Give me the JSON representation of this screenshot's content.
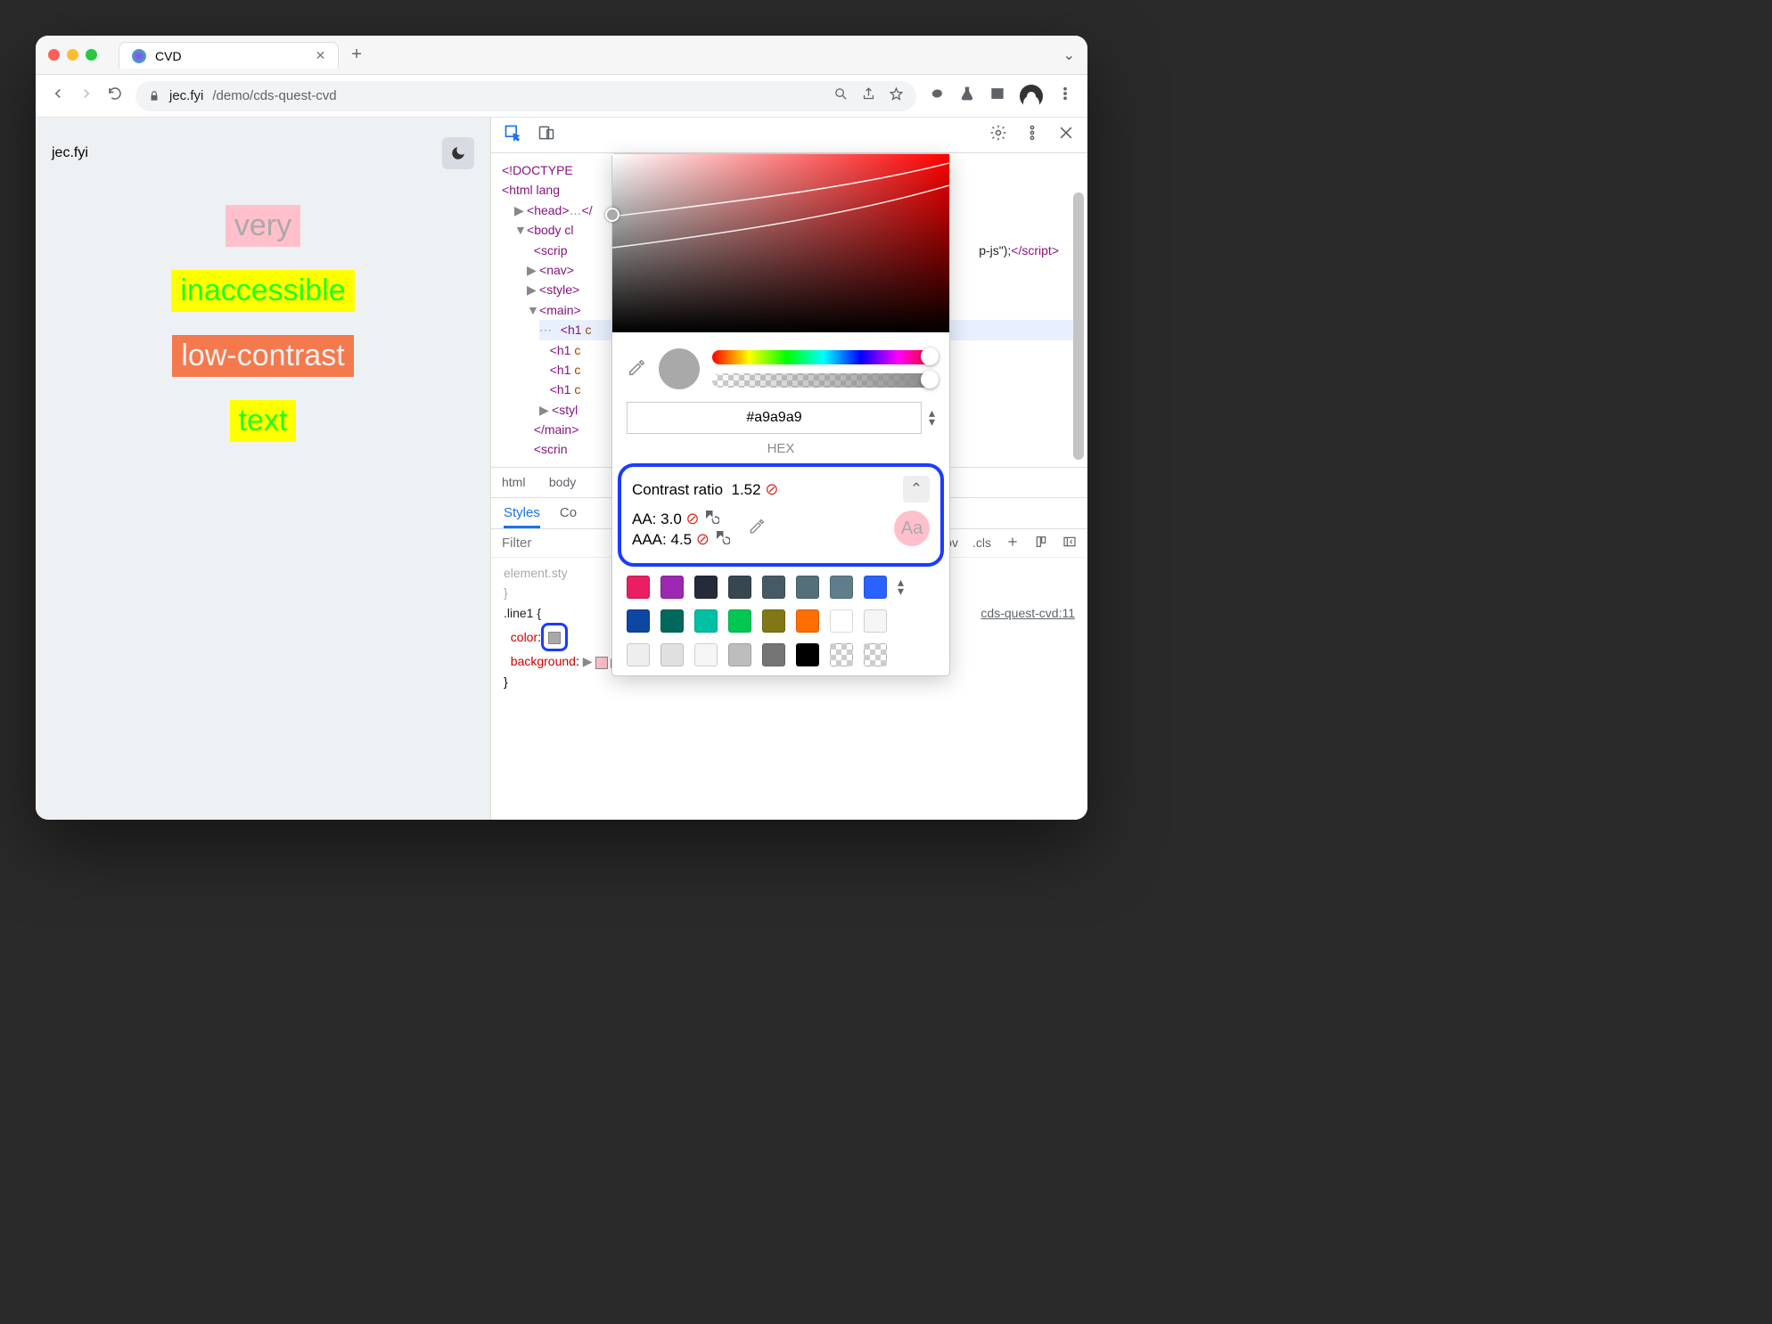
{
  "tab": {
    "title": "CVD"
  },
  "url": {
    "host": "jec.fyi",
    "path": "/demo/cds-quest-cvd"
  },
  "page": {
    "brand": "jec.fyi",
    "lines": [
      "very",
      "inaccessible",
      "low-contrast",
      "text"
    ]
  },
  "dom": {
    "doctype": "<!DOCTYPE",
    "html": "html lang",
    "head": "head",
    "body": "body cl",
    "script_inner": "p-js\");",
    "script_tag_open": "scrip",
    "script_tag_close": "script",
    "nav": "nav",
    "style": "style",
    "main": "main",
    "h1": "h1",
    "style2": "styl",
    "main_close": "main",
    "scrin": "scrin"
  },
  "crumbs": [
    "html",
    "body"
  ],
  "styles": {
    "tabs": [
      "Styles",
      "Co"
    ],
    "filter_placeholder": "Filter",
    "hov": ":hov",
    "cls": ".cls",
    "elstyle": "element.sty",
    "rule_selector": ".line1 {",
    "prop1": "color",
    "val1": " ",
    "prop2": "background",
    "val2": "pink",
    "semicolon": ";",
    "link": "cds-quest-cvd:11",
    "close": "}"
  },
  "picker": {
    "hex": "#a9a9a9",
    "hex_label": "HEX",
    "contrast_label": "Contrast ratio",
    "contrast_value": "1.52",
    "aa_label": "AA:",
    "aa_value": "3.0",
    "aaa_label": "AAA:",
    "aaa_value": "4.5",
    "preview": "Aa",
    "palette": [
      "#e91e63",
      "#9c27b0",
      "#252b39",
      "#37474f",
      "#455a64",
      "#546e7a",
      "#607d8b",
      "#2962ff",
      "#0d47a1",
      "#00695c",
      "#00bfa5",
      "#00c853",
      "#827717",
      "#ff6f00",
      "#ffffff",
      "#f5f5f5",
      "#eeeeee",
      "#e0e0e0",
      "#f5f5f5",
      "#bdbdbd",
      "#757575",
      "#000000"
    ]
  }
}
